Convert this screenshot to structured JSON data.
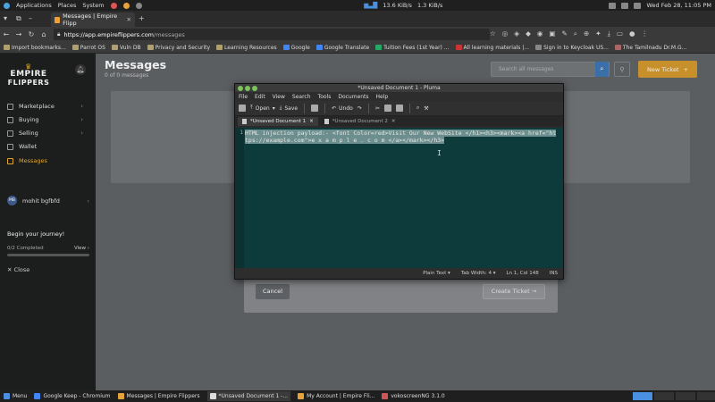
{
  "os_panel": {
    "menus": [
      "Applications",
      "Places",
      "System"
    ],
    "net_down": "13.6 KiB/s",
    "net_up": "1.3 KiB/s",
    "clock": "Wed Feb 28, 11:05 PM"
  },
  "browser": {
    "tab_title": "Messages | Empire Flipp",
    "url_domain": "https://app.empireflippers.com",
    "url_path": "/messages",
    "bookmarks": [
      "Import bookmarks...",
      "Parrot OS",
      "Vuln DB",
      "Privacy and Security",
      "Learning Resources",
      "Google",
      "Google Translate",
      "Tuition Fees (1st Year) ...",
      "All learning materials |...",
      "Sign in to Keycloak US...",
      "The Tamilnadu Dr.M.G..."
    ]
  },
  "sidebar": {
    "logo_line1": "EMPIRE",
    "logo_line2": "FLIPPERS",
    "items": [
      {
        "label": "Marketplace",
        "chevron": true
      },
      {
        "label": "Buying",
        "chevron": true
      },
      {
        "label": "Selling",
        "chevron": true
      },
      {
        "label": "Wallet",
        "chevron": false
      },
      {
        "label": "Messages",
        "chevron": false
      }
    ],
    "user_initials": "MB",
    "user_name": "mohit bgfbfd",
    "journey_title": "Begin your journey!",
    "journey_progress_text": "0/2 Completed",
    "journey_progress": 0,
    "journey_view": "View",
    "close_label": "Close"
  },
  "main": {
    "title": "Messages",
    "subtitle": "0 of 0 messages",
    "search_placeholder": "Search all messages",
    "new_ticket": "New Ticket",
    "cancel": "Cancel",
    "create_ticket": "Create Ticket"
  },
  "pluma": {
    "title": "*Unsaved Document 1 - Pluma",
    "menu": [
      "File",
      "Edit",
      "View",
      "Search",
      "Tools",
      "Documents",
      "Help"
    ],
    "toolbar": {
      "open": "Open",
      "save": "Save",
      "undo": "Undo"
    },
    "tabs": [
      "*Unsaved Document 1",
      "*Unsaved Document 2"
    ],
    "line_number": "1",
    "code_selected": "HTML injection payload:- ",
    "code_rest": "<font Color=red>Visit Our New WebSite </h1><h3><mark><a href=\"https://example.com\">e x a m p l e . c o m </a></mark></h3>",
    "status": {
      "mode": "Plain Text",
      "tab_width": "Tab Width: 4",
      "position": "Ln 1, Col 148",
      "ins": "INS"
    }
  },
  "taskbar": {
    "menu": "Menu",
    "tasks": [
      "Google Keep - Chromium",
      "Messages | Empire Flippers",
      "*Unsaved Document 1 -...",
      "My Account | Empire Fli...",
      "vokoscreenNG 3.1.0"
    ]
  },
  "colors": {
    "accent": "#e3a72f",
    "editor_bg": "#0d3b3b",
    "search_button": "#3a6fa8"
  }
}
